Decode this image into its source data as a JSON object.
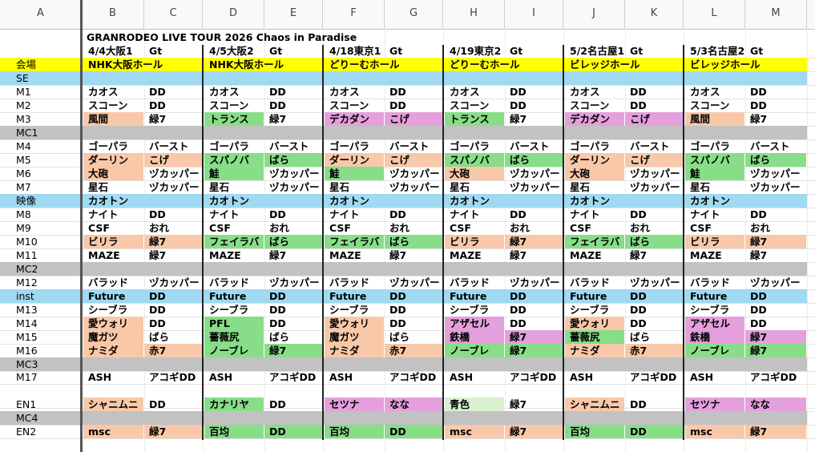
{
  "columns": [
    "A",
    "B",
    "C",
    "D",
    "E",
    "F",
    "G",
    "H",
    "I",
    "J",
    "K",
    "L",
    "M"
  ],
  "title": "GRANRODEO LIVE TOUR 2026 Chaos in Paradise",
  "colors": {
    "venue": "#ffff00",
    "blue": "#9fd9f2",
    "gray": "#c2c2c2",
    "peach": "#f8c8a8",
    "green": "#88dd88",
    "pink": "#e4a0dc",
    "lightgreen": "#d8f0d0"
  },
  "row_labels": [
    "会場",
    "SE",
    "M1",
    "M2",
    "M3",
    "MC1",
    "M4",
    "M5",
    "M6",
    "M7",
    "映像",
    "M8",
    "M9",
    "M10",
    "M11",
    "MC2",
    "M12",
    "inst",
    "M13",
    "M14",
    "M15",
    "M16",
    "MC3",
    "M17",
    "",
    "EN1",
    "MC4",
    "EN2"
  ],
  "row_fills": [
    "venue",
    "blue",
    "",
    "",
    "",
    "gray",
    "",
    "",
    "",
    "",
    "blue",
    "",
    "",
    "",
    "",
    "gray",
    "",
    "blue",
    "",
    "",
    "",
    "",
    "gray",
    "",
    "",
    "",
    "gray",
    ""
  ],
  "shows": [
    {
      "header": "4/4大阪1",
      "gt": "Gt",
      "venue": "NHK大阪ホール",
      "cells": [
        [
          "",
          ""
        ],
        [
          "",
          ""
        ],
        [
          "カオス",
          "DD"
        ],
        [
          "スコーン",
          "DD"
        ],
        [
          "風間",
          "緑7"
        ],
        [
          "",
          ""
        ],
        [
          "ゴーパラ",
          "バースト"
        ],
        [
          "ダーリン",
          "こげ"
        ],
        [
          "大砲",
          "ヅカッパー"
        ],
        [
          "星石",
          "ヅカッパー"
        ],
        [
          "カオトン",
          ""
        ],
        [
          "ナイト",
          "DD"
        ],
        [
          "CSF",
          "おれ"
        ],
        [
          "ビリラ",
          "緑7"
        ],
        [
          "MAZE",
          "緑7"
        ],
        [
          "",
          ""
        ],
        [
          "バラッド",
          "ヅカッパー"
        ],
        [
          "Future",
          "DD"
        ],
        [
          "シーブラ",
          "DD"
        ],
        [
          "愛ウォリ",
          "DD"
        ],
        [
          "魔ガツ",
          "ばら"
        ],
        [
          "ナミダ",
          "赤7"
        ],
        [
          "",
          ""
        ],
        [
          "ASH",
          "アコギDD"
        ],
        [
          "",
          ""
        ],
        [
          "シャニムニ",
          "DD"
        ],
        [
          "",
          ""
        ],
        [
          "msc",
          "緑7"
        ]
      ],
      "fills": [
        [
          "",
          ""
        ],
        [
          "",
          ""
        ],
        [
          "",
          ""
        ],
        [
          "",
          ""
        ],
        [
          "peach",
          ""
        ],
        [
          "",
          ""
        ],
        [
          "",
          ""
        ],
        [
          "peach",
          "peach"
        ],
        [
          "peach",
          ""
        ],
        [
          "",
          ""
        ],
        [
          "",
          ""
        ],
        [
          "",
          ""
        ],
        [
          "",
          ""
        ],
        [
          "peach",
          "peach"
        ],
        [
          "",
          ""
        ],
        [
          "",
          ""
        ],
        [
          "",
          ""
        ],
        [
          "",
          ""
        ],
        [
          "",
          ""
        ],
        [
          "peach",
          ""
        ],
        [
          "peach",
          ""
        ],
        [
          "peach",
          "peach"
        ],
        [
          "",
          ""
        ],
        [
          "",
          ""
        ],
        [
          "",
          ""
        ],
        [
          "peach",
          ""
        ],
        [
          "",
          ""
        ],
        [
          "peach",
          "peach"
        ]
      ]
    },
    {
      "header": "4/5大阪2",
      "gt": "Gt",
      "venue": "NHK大阪ホール",
      "cells": [
        [
          "",
          ""
        ],
        [
          "",
          ""
        ],
        [
          "カオス",
          "DD"
        ],
        [
          "スコーン",
          "DD"
        ],
        [
          "トランス",
          "緑7"
        ],
        [
          "",
          ""
        ],
        [
          "ゴーパラ",
          "バースト"
        ],
        [
          "スパノバ",
          "ばら"
        ],
        [
          "鮭",
          "ヅカッパー"
        ],
        [
          "星石",
          "ヅカッパー"
        ],
        [
          "カオトン",
          ""
        ],
        [
          "ナイト",
          "DD"
        ],
        [
          "CSF",
          "おれ"
        ],
        [
          "フェイラバ",
          "ばら"
        ],
        [
          "MAZE",
          "緑7"
        ],
        [
          "",
          ""
        ],
        [
          "バラッド",
          "ヅカッパー"
        ],
        [
          "Future",
          "DD"
        ],
        [
          "シーブラ",
          "DD"
        ],
        [
          "PFL",
          "DD"
        ],
        [
          "薔薇尻",
          "ばら"
        ],
        [
          "ノーブレ",
          "緑7"
        ],
        [
          "",
          ""
        ],
        [
          "ASH",
          "アコギDD"
        ],
        [
          "",
          ""
        ],
        [
          "カナリヤ",
          "DD"
        ],
        [
          "",
          ""
        ],
        [
          "百均",
          "DD"
        ]
      ],
      "fills": [
        [
          "",
          ""
        ],
        [
          "",
          ""
        ],
        [
          "",
          ""
        ],
        [
          "",
          ""
        ],
        [
          "green",
          ""
        ],
        [
          "",
          ""
        ],
        [
          "",
          ""
        ],
        [
          "green",
          "green"
        ],
        [
          "green",
          ""
        ],
        [
          "",
          ""
        ],
        [
          "",
          ""
        ],
        [
          "",
          ""
        ],
        [
          "",
          ""
        ],
        [
          "green",
          "green"
        ],
        [
          "",
          ""
        ],
        [
          "",
          ""
        ],
        [
          "",
          ""
        ],
        [
          "",
          ""
        ],
        [
          "",
          ""
        ],
        [
          "green",
          ""
        ],
        [
          "green",
          ""
        ],
        [
          "green",
          "green"
        ],
        [
          "",
          ""
        ],
        [
          "",
          ""
        ],
        [
          "",
          ""
        ],
        [
          "green",
          ""
        ],
        [
          "",
          ""
        ],
        [
          "green",
          "green"
        ]
      ]
    },
    {
      "header": "4/18東京1",
      "gt": "Gt",
      "venue": "どりーむホール",
      "cells": [
        [
          "",
          ""
        ],
        [
          "",
          ""
        ],
        [
          "カオス",
          "DD"
        ],
        [
          "スコーン",
          "DD"
        ],
        [
          "デカダン",
          "こげ"
        ],
        [
          "",
          ""
        ],
        [
          "ゴーパラ",
          "バースト"
        ],
        [
          "ダーリン",
          "こげ"
        ],
        [
          "鮭",
          "ヅカッパー"
        ],
        [
          "星石",
          "ヅカッパー"
        ],
        [
          "カオトン",
          ""
        ],
        [
          "ナイト",
          "DD"
        ],
        [
          "CSF",
          "おれ"
        ],
        [
          "フェイラバ",
          "ばら"
        ],
        [
          "MAZE",
          "緑7"
        ],
        [
          "",
          ""
        ],
        [
          "バラッド",
          "ヅカッパー"
        ],
        [
          "Future",
          "DD"
        ],
        [
          "シーブラ",
          "DD"
        ],
        [
          "愛ウォリ",
          "DD"
        ],
        [
          "魔ガツ",
          "ばら"
        ],
        [
          "ナミダ",
          "赤7"
        ],
        [
          "",
          ""
        ],
        [
          "ASH",
          "アコギDD"
        ],
        [
          "",
          ""
        ],
        [
          "セツナ",
          "なな"
        ],
        [
          "",
          ""
        ],
        [
          "百均",
          "DD"
        ]
      ],
      "fills": [
        [
          "",
          ""
        ],
        [
          "",
          ""
        ],
        [
          "",
          ""
        ],
        [
          "",
          ""
        ],
        [
          "pink",
          "pink"
        ],
        [
          "",
          ""
        ],
        [
          "",
          ""
        ],
        [
          "peach",
          "peach"
        ],
        [
          "green",
          ""
        ],
        [
          "",
          ""
        ],
        [
          "",
          ""
        ],
        [
          "",
          ""
        ],
        [
          "",
          ""
        ],
        [
          "green",
          "green"
        ],
        [
          "",
          ""
        ],
        [
          "",
          ""
        ],
        [
          "",
          ""
        ],
        [
          "",
          ""
        ],
        [
          "",
          ""
        ],
        [
          "peach",
          ""
        ],
        [
          "peach",
          ""
        ],
        [
          "peach",
          "peach"
        ],
        [
          "",
          ""
        ],
        [
          "",
          ""
        ],
        [
          "",
          ""
        ],
        [
          "pink",
          "pink"
        ],
        [
          "",
          ""
        ],
        [
          "green",
          "green"
        ]
      ]
    },
    {
      "header": "4/19東京2",
      "gt": "Gt",
      "venue": "どりーむホール",
      "cells": [
        [
          "",
          ""
        ],
        [
          "",
          ""
        ],
        [
          "カオス",
          "DD"
        ],
        [
          "スコーン",
          "DD"
        ],
        [
          "トランス",
          "緑7"
        ],
        [
          "",
          ""
        ],
        [
          "ゴーパラ",
          "バースト"
        ],
        [
          "スパノバ",
          "ばら"
        ],
        [
          "大砲",
          "ヅカッパー"
        ],
        [
          "星石",
          "ヅカッパー"
        ],
        [
          "カオトン",
          ""
        ],
        [
          "ナイト",
          "DD"
        ],
        [
          "CSF",
          "おれ"
        ],
        [
          "ビリラ",
          "緑7"
        ],
        [
          "MAZE",
          "緑7"
        ],
        [
          "",
          ""
        ],
        [
          "バラッド",
          "ヅカッパー"
        ],
        [
          "Future",
          "DD"
        ],
        [
          "シーブラ",
          "DD"
        ],
        [
          "アザセル",
          "DD"
        ],
        [
          "鉄橋",
          "緑7"
        ],
        [
          "ノーブレ",
          "緑7"
        ],
        [
          "",
          ""
        ],
        [
          "ASH",
          "アコギDD"
        ],
        [
          "",
          ""
        ],
        [
          "青色",
          "緑7"
        ],
        [
          "",
          ""
        ],
        [
          "msc",
          "緑7"
        ]
      ],
      "fills": [
        [
          "",
          ""
        ],
        [
          "",
          ""
        ],
        [
          "",
          ""
        ],
        [
          "",
          ""
        ],
        [
          "green",
          ""
        ],
        [
          "",
          ""
        ],
        [
          "",
          ""
        ],
        [
          "green",
          "green"
        ],
        [
          "peach",
          ""
        ],
        [
          "",
          ""
        ],
        [
          "",
          ""
        ],
        [
          "",
          ""
        ],
        [
          "",
          ""
        ],
        [
          "peach",
          "peach"
        ],
        [
          "",
          ""
        ],
        [
          "",
          ""
        ],
        [
          "",
          ""
        ],
        [
          "",
          ""
        ],
        [
          "",
          ""
        ],
        [
          "pink",
          ""
        ],
        [
          "pink",
          "pink"
        ],
        [
          "green",
          "green"
        ],
        [
          "",
          ""
        ],
        [
          "",
          ""
        ],
        [
          "",
          ""
        ],
        [
          "lightgreen",
          ""
        ],
        [
          "",
          ""
        ],
        [
          "peach",
          "peach"
        ]
      ]
    },
    {
      "header": "5/2名古屋1",
      "gt": "Gt",
      "venue": "ビレッジホール",
      "cells": [
        [
          "",
          ""
        ],
        [
          "",
          ""
        ],
        [
          "カオス",
          "DD"
        ],
        [
          "スコーン",
          "DD"
        ],
        [
          "デカダン",
          "こげ"
        ],
        [
          "",
          ""
        ],
        [
          "ゴーパラ",
          "バースト"
        ],
        [
          "ダーリン",
          "こげ"
        ],
        [
          "大砲",
          "ヅカッパー"
        ],
        [
          "星石",
          "ヅカッパー"
        ],
        [
          "カオトン",
          ""
        ],
        [
          "ナイト",
          "DD"
        ],
        [
          "CSF",
          "おれ"
        ],
        [
          "フェイラバ",
          "ばら"
        ],
        [
          "MAZE",
          "緑7"
        ],
        [
          "",
          ""
        ],
        [
          "バラッド",
          "ヅカッパー"
        ],
        [
          "Future",
          "DD"
        ],
        [
          "シーブラ",
          "DD"
        ],
        [
          "愛ウォリ",
          "DD"
        ],
        [
          "薔薇尻",
          "ばら"
        ],
        [
          "ナミダ",
          "赤7"
        ],
        [
          "",
          ""
        ],
        [
          "ASH",
          "アコギDD"
        ],
        [
          "",
          ""
        ],
        [
          "シャニムニ",
          "DD"
        ],
        [
          "",
          ""
        ],
        [
          "百均",
          "DD"
        ]
      ],
      "fills": [
        [
          "",
          ""
        ],
        [
          "",
          ""
        ],
        [
          "",
          ""
        ],
        [
          "",
          ""
        ],
        [
          "pink",
          "pink"
        ],
        [
          "",
          ""
        ],
        [
          "",
          ""
        ],
        [
          "peach",
          "peach"
        ],
        [
          "peach",
          ""
        ],
        [
          "",
          ""
        ],
        [
          "",
          ""
        ],
        [
          "",
          ""
        ],
        [
          "",
          ""
        ],
        [
          "green",
          "green"
        ],
        [
          "",
          ""
        ],
        [
          "",
          ""
        ],
        [
          "",
          ""
        ],
        [
          "",
          ""
        ],
        [
          "",
          ""
        ],
        [
          "peach",
          ""
        ],
        [
          "green",
          ""
        ],
        [
          "peach",
          "peach"
        ],
        [
          "",
          ""
        ],
        [
          "",
          ""
        ],
        [
          "",
          ""
        ],
        [
          "peach",
          ""
        ],
        [
          "",
          ""
        ],
        [
          "green",
          "green"
        ]
      ]
    },
    {
      "header": "5/3名古屋2",
      "gt": "Gt",
      "venue": "ビレッジホール",
      "cells": [
        [
          "",
          ""
        ],
        [
          "",
          ""
        ],
        [
          "カオス",
          "DD"
        ],
        [
          "スコーン",
          "DD"
        ],
        [
          "風間",
          "緑7"
        ],
        [
          "",
          ""
        ],
        [
          "ゴーパラ",
          "バースト"
        ],
        [
          "スパノバ",
          "ばら"
        ],
        [
          "鮭",
          "ヅカッパー"
        ],
        [
          "星石",
          "ヅカッパー"
        ],
        [
          "カオトン",
          ""
        ],
        [
          "ナイト",
          "DD"
        ],
        [
          "CSF",
          "おれ"
        ],
        [
          "ビリラ",
          "緑7"
        ],
        [
          "MAZE",
          "緑7"
        ],
        [
          "",
          ""
        ],
        [
          "バラッド",
          "ヅカッパー"
        ],
        [
          "Future",
          "DD"
        ],
        [
          "シーブラ",
          "DD"
        ],
        [
          "アザセル",
          "DD"
        ],
        [
          "鉄橋",
          "緑7"
        ],
        [
          "ノーブレ",
          "緑7"
        ],
        [
          "",
          ""
        ],
        [
          "ASH",
          "アコギDD"
        ],
        [
          "",
          ""
        ],
        [
          "セツナ",
          "なな"
        ],
        [
          "",
          ""
        ],
        [
          "msc",
          "緑7"
        ]
      ],
      "fills": [
        [
          "",
          ""
        ],
        [
          "",
          ""
        ],
        [
          "",
          ""
        ],
        [
          "",
          ""
        ],
        [
          "peach",
          ""
        ],
        [
          "",
          ""
        ],
        [
          "",
          ""
        ],
        [
          "green",
          "green"
        ],
        [
          "green",
          ""
        ],
        [
          "",
          ""
        ],
        [
          "",
          ""
        ],
        [
          "",
          ""
        ],
        [
          "",
          ""
        ],
        [
          "peach",
          "peach"
        ],
        [
          "",
          ""
        ],
        [
          "",
          ""
        ],
        [
          "",
          ""
        ],
        [
          "",
          ""
        ],
        [
          "",
          ""
        ],
        [
          "pink",
          ""
        ],
        [
          "pink",
          "pink"
        ],
        [
          "green",
          "green"
        ],
        [
          "",
          ""
        ],
        [
          "",
          ""
        ],
        [
          "",
          ""
        ],
        [
          "pink",
          "pink"
        ],
        [
          "",
          ""
        ],
        [
          "peach",
          "peach"
        ]
      ]
    }
  ]
}
